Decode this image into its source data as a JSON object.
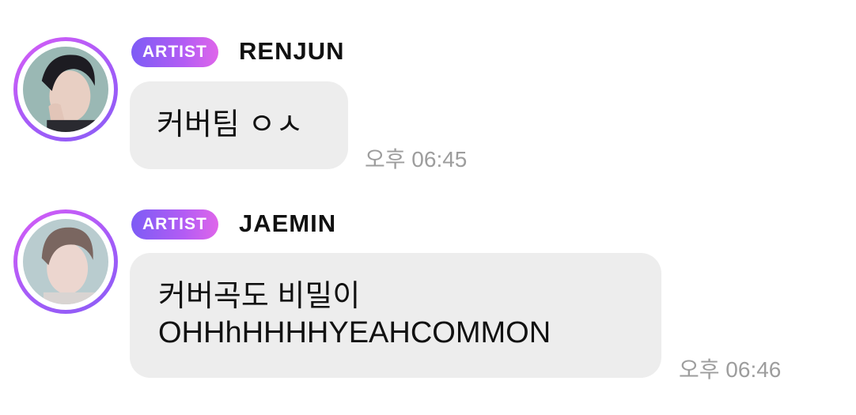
{
  "messages": [
    {
      "badge": "ARTIST",
      "name": "RENJUN",
      "lines": [
        "커버팀 ㅇㅅ"
      ],
      "time": "오후 06:45"
    },
    {
      "badge": "ARTIST",
      "name": "JAEMIN",
      "lines": [
        "커버곡도 비밀이",
        "OHHhHHHHYEAHCOMMON"
      ],
      "time": "오후 06:46"
    }
  ],
  "colors": {
    "badge_gradient_start": "#7d5cf5",
    "badge_gradient_end": "#df66ea",
    "avatar_ring": "#b05cf6",
    "bubble_bg": "#ededed",
    "timestamp": "#9d9d9d"
  },
  "icons": [
    "avatar-renjun",
    "avatar-jaemin"
  ]
}
